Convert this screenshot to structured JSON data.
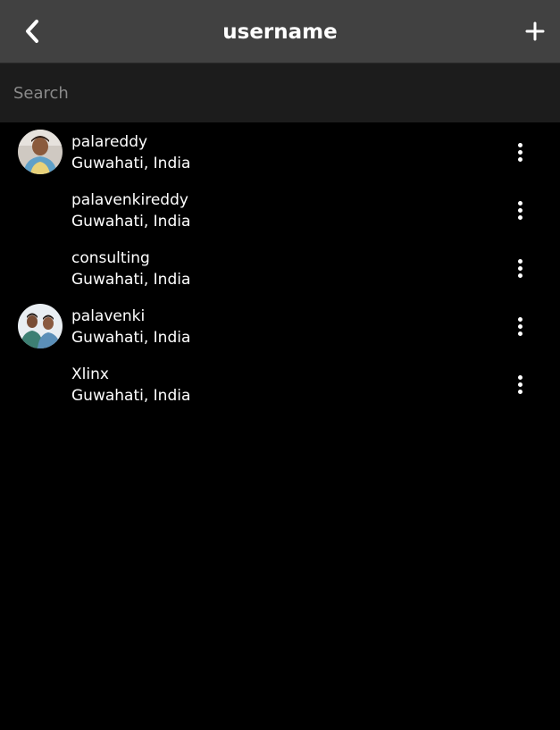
{
  "header": {
    "title": "username",
    "back_icon": "chevron-left-icon",
    "add_icon": "plus-icon",
    "background": "#414141"
  },
  "search": {
    "placeholder": "Search",
    "value": ""
  },
  "items": [
    {
      "name": "palareddy",
      "location": "Guwahati, India",
      "has_avatar": true
    },
    {
      "name": "palavenkireddy",
      "location": "Guwahati, India",
      "has_avatar": false
    },
    {
      "name": "consulting",
      "location": "Guwahati, India",
      "has_avatar": false
    },
    {
      "name": "palavenki",
      "location": "Guwahati, India",
      "has_avatar": true
    },
    {
      "name": "Xlinx",
      "location": "Guwahati, India",
      "has_avatar": false
    }
  ],
  "colors": {
    "background": "#000000",
    "search_background": "#1c1c1c",
    "text": "#ffffff"
  }
}
